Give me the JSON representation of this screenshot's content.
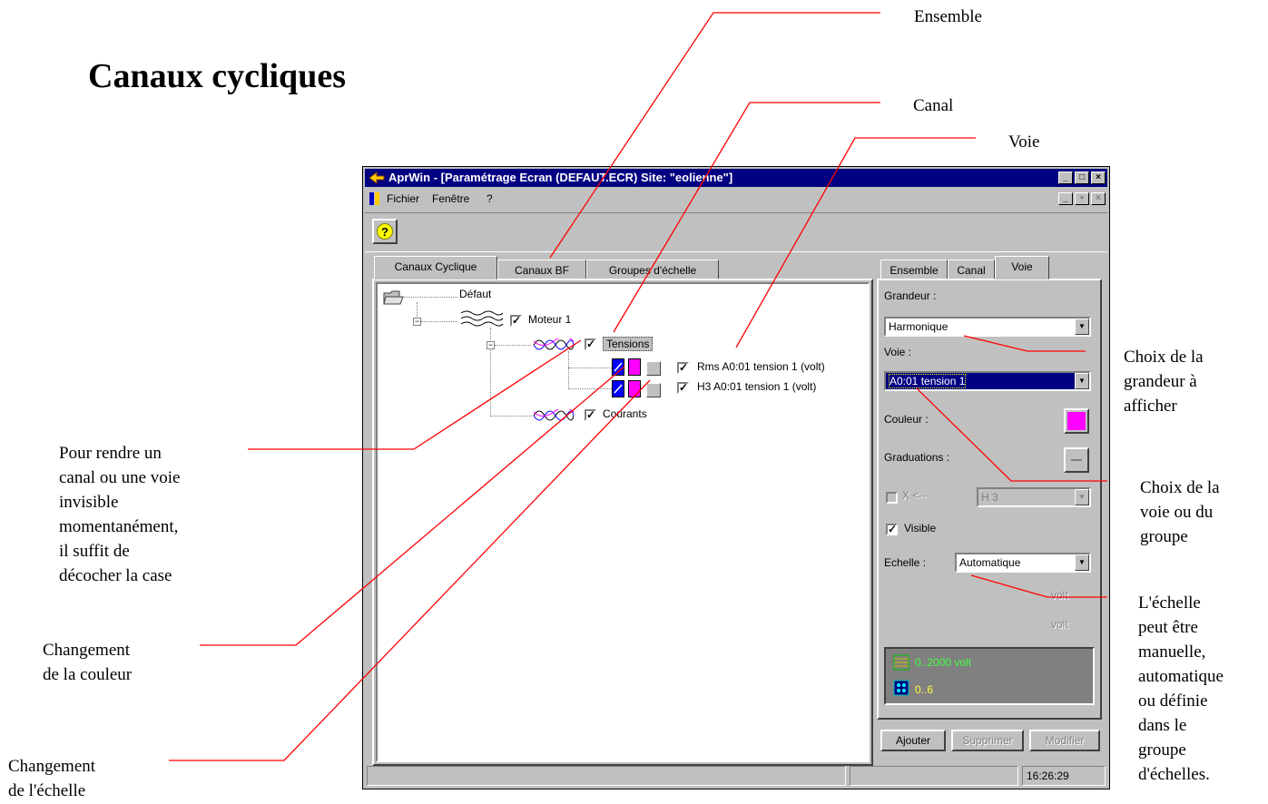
{
  "document": {
    "title": "Canaux cycliques"
  },
  "callouts": {
    "ensemble": "Ensemble",
    "canal": "Canal",
    "voie": "Voie",
    "choix_grandeur": [
      "Choix de la",
      "grandeur à",
      "afficher"
    ],
    "choix_voie": [
      "Choix de la",
      "voie ou du",
      "groupe"
    ],
    "echelle": [
      "L'échelle",
      "peut être",
      "manuelle,",
      "automatique",
      "ou définie",
      "dans le",
      "groupe",
      "d'échelles."
    ],
    "invisible": [
      "Pour rendre un",
      "canal ou une voie",
      "invisible",
      "momentanément,",
      "il suffit de",
      "décocher la case"
    ],
    "couleur": [
      "Changement",
      "de la couleur"
    ],
    "changement_echelle": [
      "Changement",
      "de l'échelle"
    ]
  },
  "window": {
    "title": "AprWin  - [Paramétrage Ecran  (DEFAUT.ECR)   Site: \"eolienne\"]",
    "caption_buttons": [
      "_",
      "□",
      "×"
    ],
    "menu": [
      "Fichier",
      "Fenêtre",
      "?"
    ],
    "mdi_buttons": [
      "_",
      "▫",
      "×"
    ],
    "toolbar": {
      "help_label": "?"
    },
    "left_tabs": [
      "Canaux Cyclique",
      "Canaux BF",
      "Groupes d'échelle"
    ],
    "right_tabs": [
      "Ensemble",
      "Canal",
      "Voie"
    ],
    "tree": {
      "root": "Défaut",
      "ensemble": "Moteur 1",
      "canal1": "Tensions",
      "voie1": "Rms A0:01 tension 1   (volt)",
      "voie2": "H3 A0:01 tension 1   (volt)",
      "canal2": "Courants"
    },
    "props": {
      "grandeur_label": "Grandeur :",
      "grandeur_value": "Harmonique",
      "voie_label": "Voie :",
      "voie_value": "A0:01 tension 1",
      "couleur_label": "Couleur :",
      "couleur_color": "#ff00ff",
      "graduations_label": "Graduations :",
      "harmonic_check_label": "X <--",
      "harmonic_value": "H 3",
      "visible_label": "Visible",
      "echelle_label": "Echelle :",
      "echelle_value": "Automatique",
      "unit1": "volt",
      "unit2": "volt",
      "info_line1": "0..2000 volt",
      "info_line2": "0..6"
    },
    "buttons": {
      "ajouter": "Ajouter",
      "supprimer": "Supprimer",
      "modifier": "Modifier"
    },
    "status": {
      "time": "16:26:29"
    }
  },
  "colors": {
    "titlebar": "#000080",
    "magenta": "#ff00ff",
    "blue_swatch": "#0000ff",
    "callout_line": "#ff0000"
  }
}
